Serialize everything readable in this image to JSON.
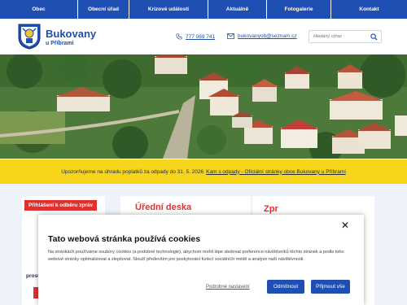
{
  "nav": {
    "items": [
      {
        "label": "Obec"
      },
      {
        "label": "Obecní úřad"
      },
      {
        "label": "Krizové události"
      },
      {
        "label": "Aktuálně"
      },
      {
        "label": "Fotogalerie"
      },
      {
        "label": "Kontakt"
      }
    ]
  },
  "header": {
    "brand_name": "Bukovany",
    "brand_sub": "u Příbrami",
    "phone": "777 069 741",
    "email": "bukovanyob@seznam.cz",
    "search_placeholder": "Hledaný výraz",
    "phone_icon": "phone-icon",
    "mail_icon": "mail-icon",
    "search_icon": "search-icon"
  },
  "notice": {
    "text": "Upozorňujeme na úhradu poplatků za odpady do 31. 5. 2026",
    "link": "Kam s odpady - Oficiální stránky obce Bukovany u Příbrami"
  },
  "sections": {
    "subscribe_label": "Přihlášení k odběru zpráv",
    "subscribe_text": "prost",
    "board_title": "Úřední deska",
    "right_title": "Zpr"
  },
  "cookie": {
    "title": "Tato webová stránka používá cookies",
    "text": "Na stránkách používáme soubory cookies (a podobné technologie), abychom mohli lépe sledovat preference návštěvníků těchto stránek a podle toho webové stránky optimalizovat a zlepšovat. Slouží především pro poskytování funkcí sociálních médií a analýze naší návštěvnosti.",
    "settings": "Podrobné nastavení",
    "reject": "Odmítnout",
    "accept": "Přijmout vše",
    "close_icon": "close-icon"
  },
  "colors": {
    "primary": "#1f4fb3",
    "notice_bg": "#f6d51b",
    "accent_red": "#e03131"
  }
}
